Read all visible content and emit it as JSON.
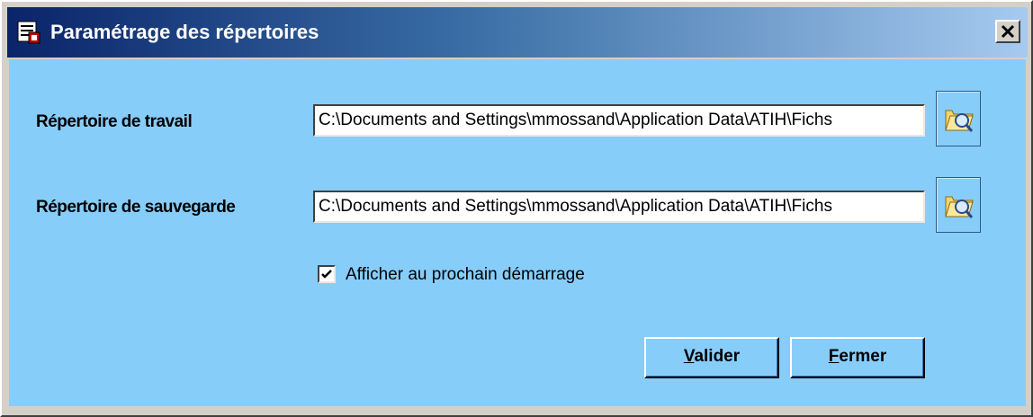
{
  "window": {
    "title": "Paramétrage des répertoires",
    "close_label": "x"
  },
  "fields": {
    "work_dir": {
      "label": "Répertoire de travail",
      "value": "C:\\Documents and Settings\\mmossand\\Application Data\\ATIH\\Fichs"
    },
    "backup_dir": {
      "label": "Répertoire de sauvegarde",
      "value": "C:\\Documents and Settings\\mmossand\\Application Data\\ATIH\\Fichs"
    }
  },
  "startup_checkbox": {
    "label": "Afficher au prochain démarrage",
    "checked": true
  },
  "buttons": {
    "validate_mnemonic": "V",
    "validate_rest": "alider",
    "close_mnemonic": "F",
    "close_rest": "ermer"
  },
  "icons": {
    "title_icon": "settings-app-icon",
    "browse_icon": "folder-search-icon",
    "check_icon": "checkmark-icon"
  },
  "colors": {
    "client_background": "#87cdfa",
    "titlebar_start": "#0a246a",
    "titlebar_end": "#a6caf0"
  }
}
